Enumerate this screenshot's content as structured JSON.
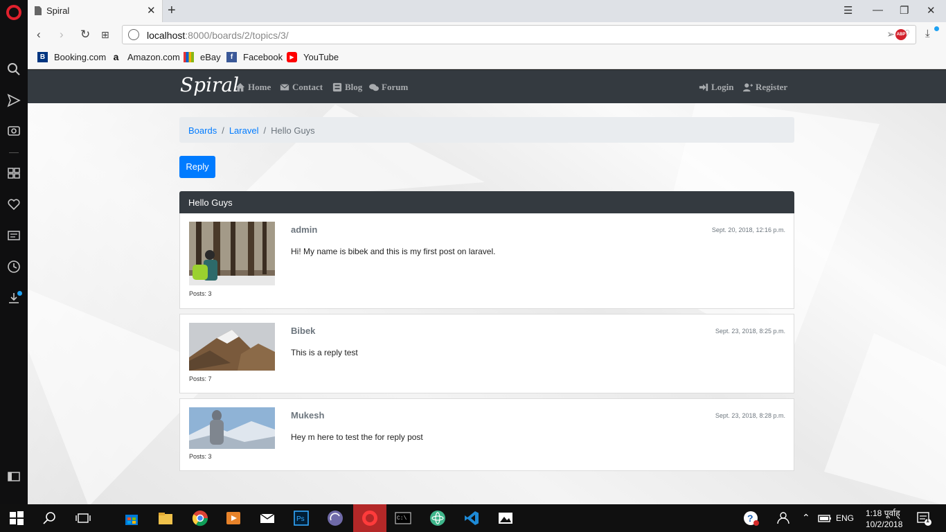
{
  "browser": {
    "tab_title": "Spiral",
    "url_host": "localhost",
    "url_path": ":8000/boards/2/topics/3/",
    "abp_label": "ABP",
    "bookmarks": [
      {
        "label": "Booking.com",
        "icon": "booking-icon",
        "color": "#003580"
      },
      {
        "label": "Amazon.com",
        "icon": "amazon-icon",
        "color": "#111111"
      },
      {
        "label": "eBay",
        "icon": "ebay-icon",
        "color": "#e53238"
      },
      {
        "label": "Facebook",
        "icon": "facebook-icon",
        "color": "#3b5998"
      },
      {
        "label": "YouTube",
        "icon": "youtube-icon",
        "color": "#ff0000"
      }
    ]
  },
  "navbar": {
    "brand": "Spiral",
    "links": [
      "Home",
      "Contact",
      "Blog",
      "Forum"
    ],
    "login": "Login",
    "register": "Register"
  },
  "breadcrumb": {
    "items": [
      "Boards",
      "Laravel",
      "Hello Guys"
    ]
  },
  "reply_button": "Reply",
  "topic": {
    "title": "Hello Guys",
    "posts": [
      {
        "author": "admin",
        "date": "Sept. 20, 2018, 12:16 p.m.",
        "text": "Hi! My name is bibek and this is my first post on laravel.",
        "posts_count": "Posts: 3"
      },
      {
        "author": "Bibek",
        "date": "Sept. 23, 2018, 8:25 p.m.",
        "text": "This is a reply test",
        "posts_count": "Posts: 7"
      },
      {
        "author": "Mukesh",
        "date": "Sept. 23, 2018, 8:28 p.m.",
        "text": "Hey m here to test the for reply post",
        "posts_count": "Posts: 3"
      }
    ]
  },
  "taskbar": {
    "time": "1:18 पूर्वाह्",
    "date": "10/2/2018",
    "lang": "ENG",
    "notif_count": "1"
  },
  "colors": {
    "primary": "#007bff",
    "navbar": "#343a40",
    "opera_red": "#e0212d"
  }
}
